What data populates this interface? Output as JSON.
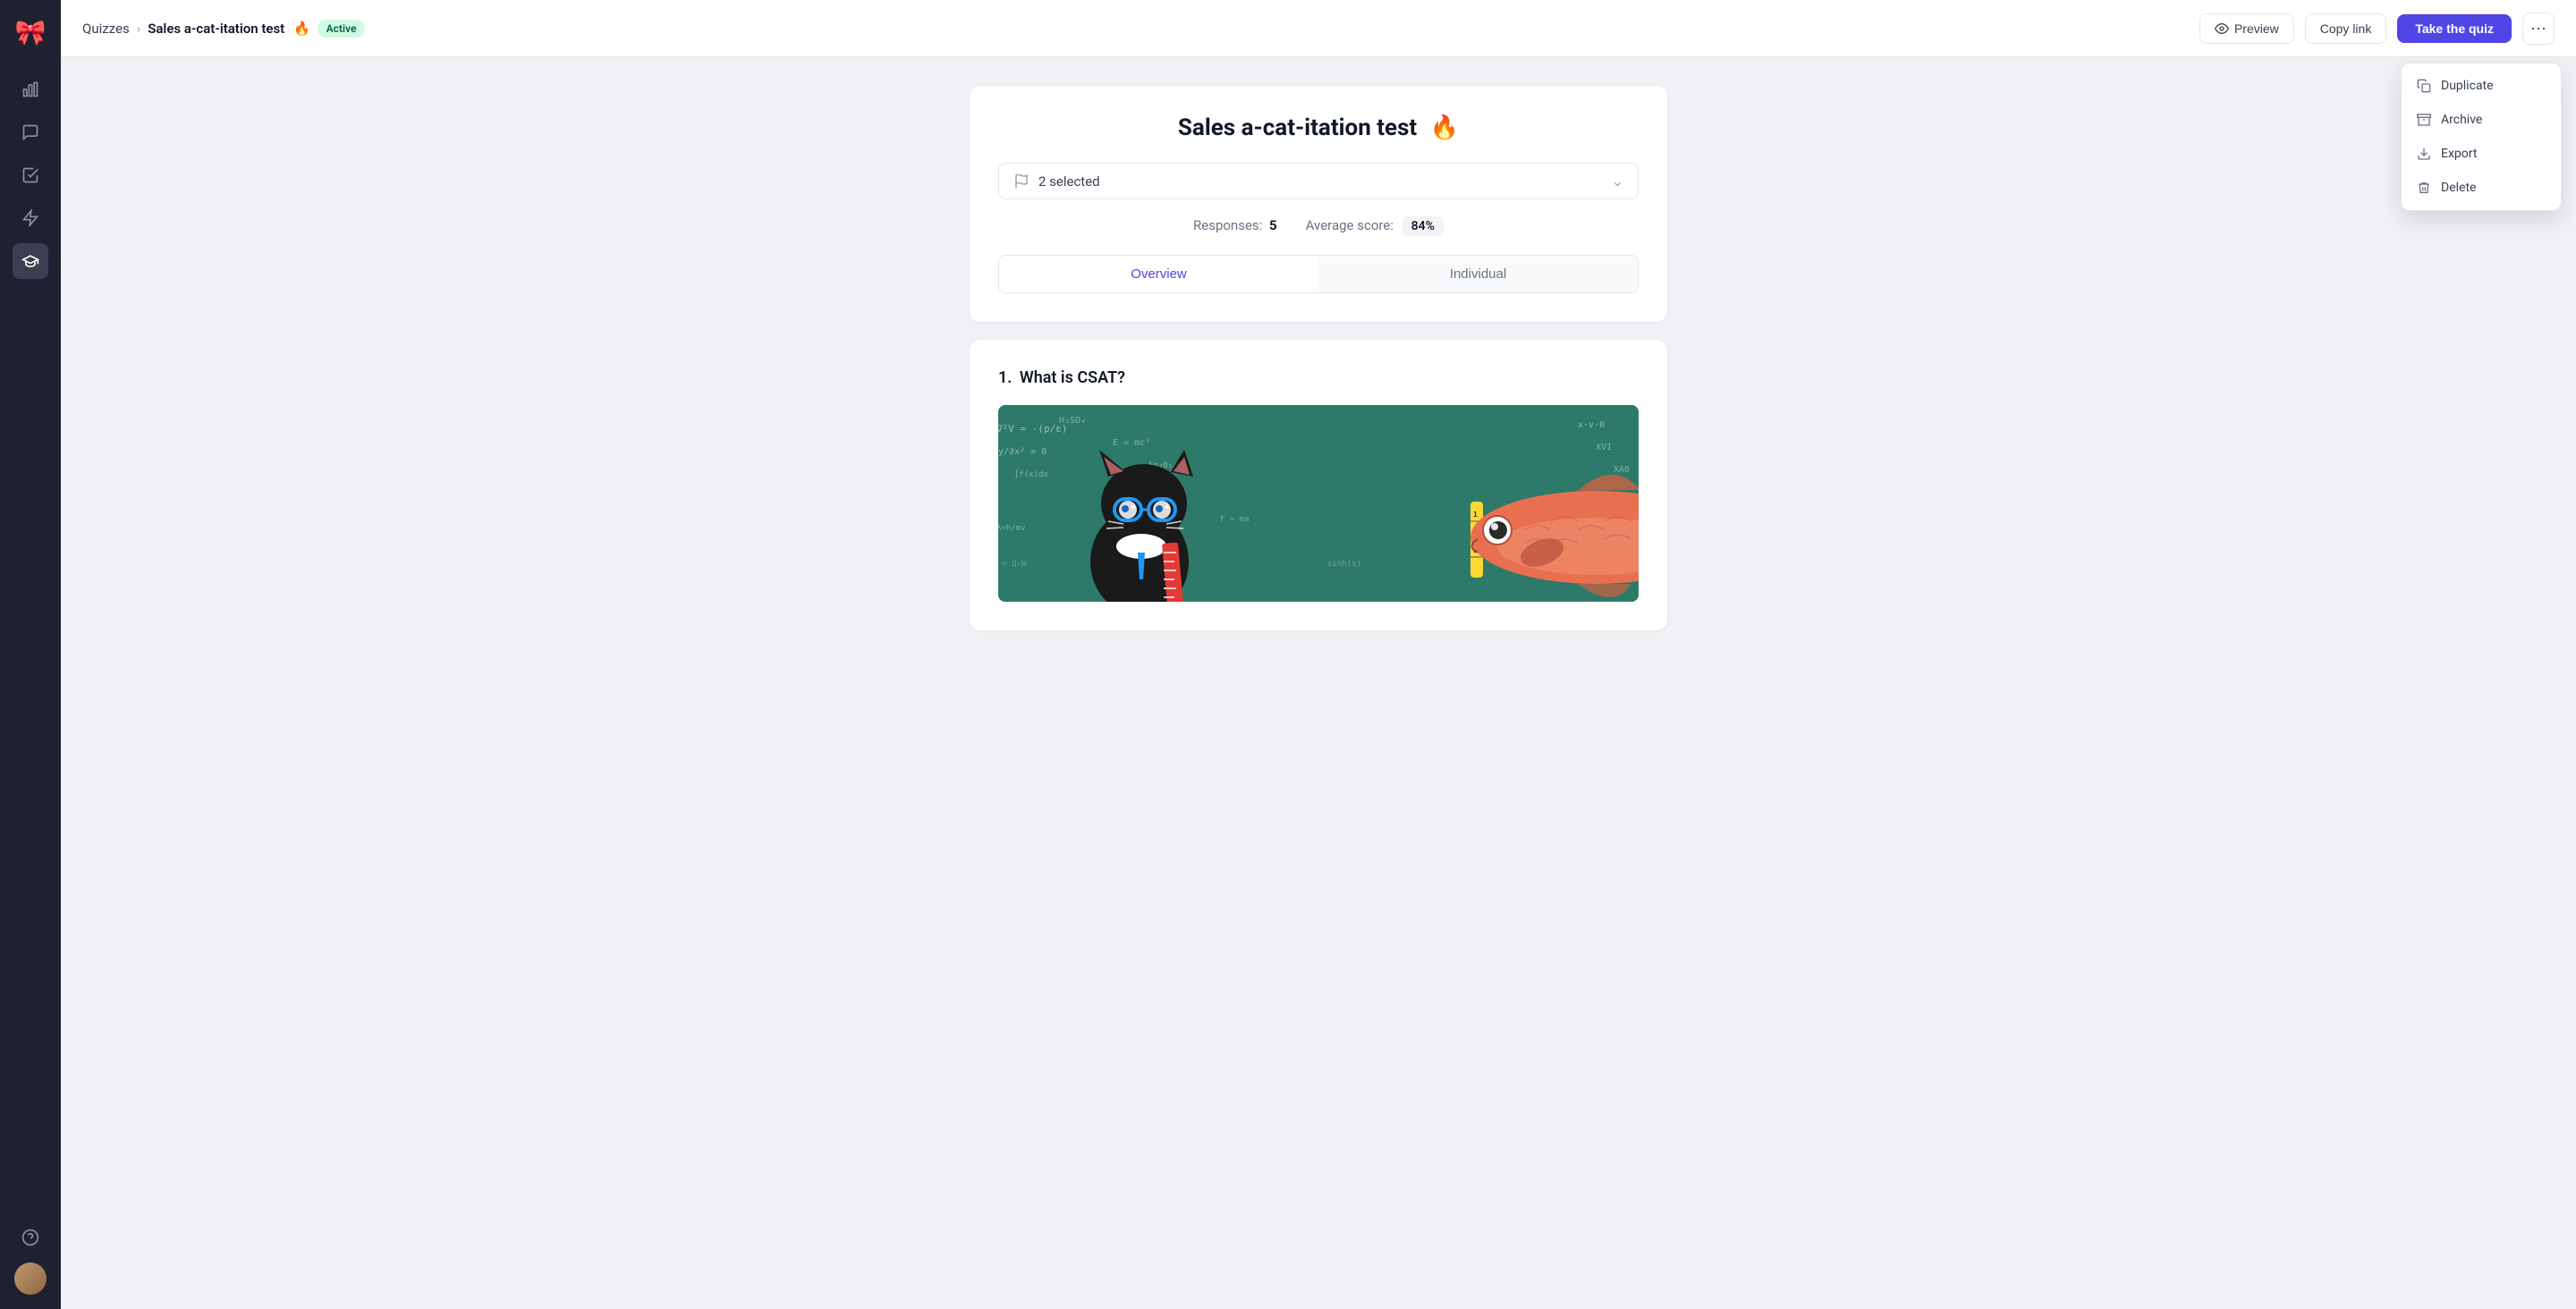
{
  "sidebar": {
    "logo_emoji": "🎀",
    "items": [
      {
        "id": "analytics",
        "icon": "📊",
        "active": false
      },
      {
        "id": "chat",
        "icon": "💬",
        "active": false
      },
      {
        "id": "check",
        "icon": "✅",
        "active": false
      },
      {
        "id": "bolt",
        "icon": "⚡",
        "active": false
      },
      {
        "id": "graduation",
        "icon": "🎓",
        "active": true
      }
    ],
    "bottom": [
      {
        "id": "help",
        "icon": "❓"
      }
    ]
  },
  "header": {
    "breadcrumb_root": "Quizzes",
    "breadcrumb_sep": "›",
    "page_title": "Sales a-cat-itation test",
    "fire_emoji": "🔥",
    "status": "Active",
    "btn_preview": "Preview",
    "btn_copy_link": "Copy link",
    "btn_take_quiz": "Take the quiz",
    "btn_more_aria": "More options"
  },
  "dropdown": {
    "items": [
      {
        "id": "duplicate",
        "label": "Duplicate",
        "icon": "duplicate"
      },
      {
        "id": "archive",
        "label": "Archive",
        "icon": "archive"
      },
      {
        "id": "export",
        "label": "Export",
        "icon": "export"
      },
      {
        "id": "delete",
        "label": "Delete",
        "icon": "delete"
      }
    ]
  },
  "quiz_card": {
    "title": "Sales a-cat-itation test",
    "fire_emoji": "🔥",
    "segment_label": "2 selected",
    "responses_label": "Responses:",
    "responses_value": "5",
    "avg_score_label": "Average score:",
    "avg_score_value": "84%",
    "tab_overview": "Overview",
    "tab_individual": "Individual"
  },
  "question_card": {
    "number": "1.",
    "title": "What is CSAT?"
  },
  "colors": {
    "accent": "#4f46e5",
    "active_badge_bg": "#d1fae5",
    "active_badge_text": "#065f46"
  }
}
